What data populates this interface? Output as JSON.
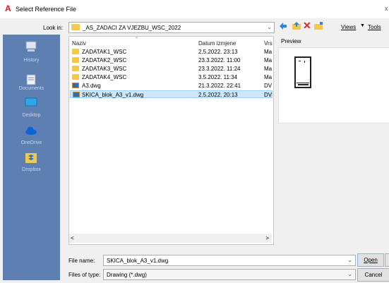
{
  "window": {
    "title": "Select Reference File",
    "close": "x"
  },
  "lookin": {
    "label": "Look in:",
    "value": "_AS_ZADACI ZA VJEZBU_WSC_2022"
  },
  "toolbar": {
    "views_label": "Views",
    "tools_label": "Tools",
    "dropdown_arrow": "▼"
  },
  "places": [
    {
      "label": "History",
      "icon": "history-icon"
    },
    {
      "label": "Documents",
      "icon": "documents-icon"
    },
    {
      "label": "Desktop",
      "icon": "desktop-icon"
    },
    {
      "label": "OneDrive",
      "icon": "onedrive-icon"
    },
    {
      "label": "Dropbox",
      "icon": "dropbox-icon"
    }
  ],
  "filelist": {
    "columns": [
      "Naziv",
      "Datum izmjene",
      "Vrs"
    ],
    "rows": [
      {
        "name": "ZADATAK1_WSC",
        "date": "2.5.2022. 23:13",
        "type": "Ma",
        "icon": "folder-icon"
      },
      {
        "name": "ZADATAK2_WSC",
        "date": "23.3.2022. 11:00",
        "type": "Ma",
        "icon": "folder-icon"
      },
      {
        "name": "ZADATAK3_WSC",
        "date": "23.3.2022. 11:24",
        "type": "Ma",
        "icon": "folder-icon"
      },
      {
        "name": "ZADATAK4_WSC",
        "date": "3.5.2022. 11:34",
        "type": "Ma",
        "icon": "folder-icon"
      },
      {
        "name": "A3.dwg",
        "date": "21.3.2022. 22:41",
        "type": "DV",
        "icon": "dwg-file-icon"
      },
      {
        "name": "SKICA_blok_A3_v1.dwg",
        "date": "2.5.2022. 20:13",
        "type": "DV",
        "icon": "dwg-file-icon",
        "selected": true
      }
    ],
    "scroll_left": "<",
    "scroll_right": ">"
  },
  "preview": {
    "label": "Preview"
  },
  "filename": {
    "label": "File name:",
    "value": "SKICA_blok_A3_v1.dwg"
  },
  "filetype": {
    "label": "Files of type:",
    "value": "Drawing (*.dwg)"
  },
  "buttons": {
    "open": "Open",
    "cancel": "Cancel"
  },
  "colors": {
    "places_bg": "#5d7fb2",
    "selection": "#cce8ff",
    "folder": "#f2c94c",
    "accent_red": "#d4181e"
  }
}
